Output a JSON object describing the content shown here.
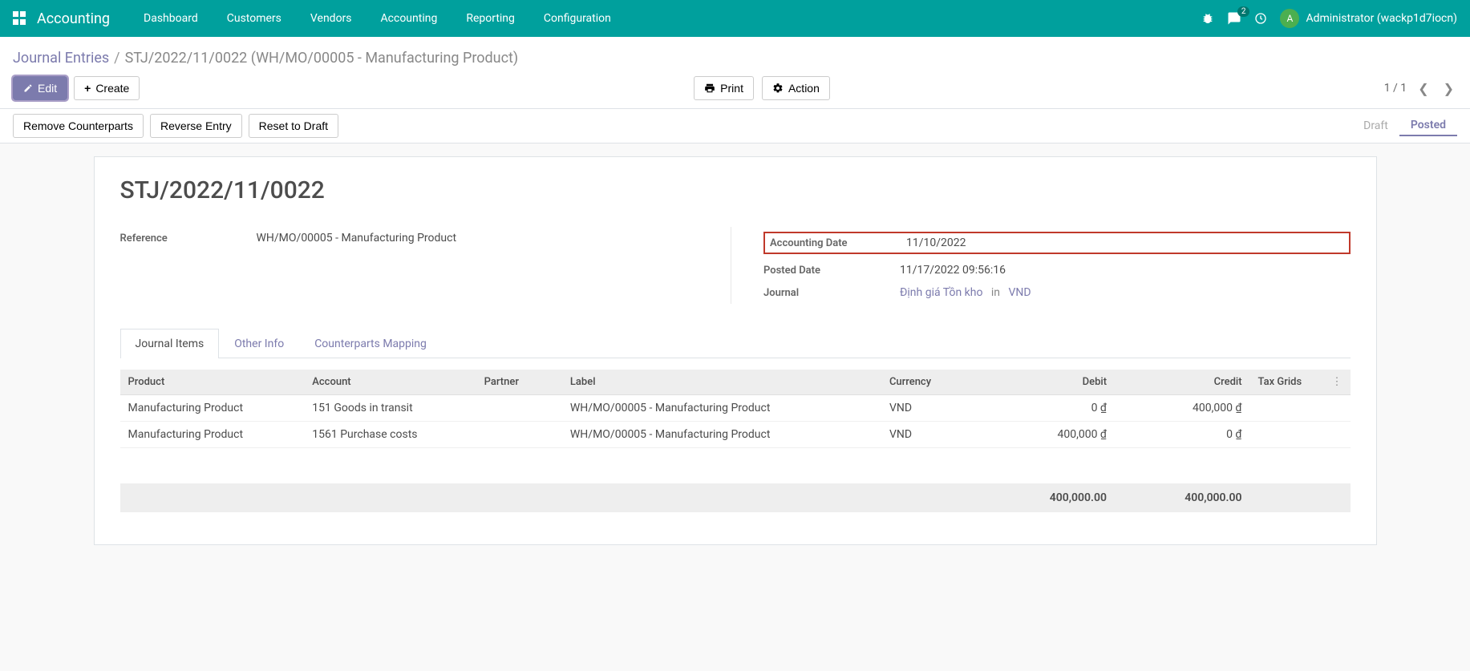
{
  "topbar": {
    "brand": "Accounting",
    "menu": [
      "Dashboard",
      "Customers",
      "Vendors",
      "Accounting",
      "Reporting",
      "Configuration"
    ],
    "messages_count": "2",
    "avatar_letter": "A",
    "user_name": "Administrator (wackp1d7iocn)"
  },
  "breadcrumb": {
    "root": "Journal Entries",
    "current": "STJ/2022/11/0022 (WH/MO/00005 - Manufacturing Product)"
  },
  "buttons": {
    "edit": "Edit",
    "create": "Create",
    "print": "Print",
    "action": "Action",
    "remove_counterparts": "Remove Counterparts",
    "reverse_entry": "Reverse Entry",
    "reset_draft": "Reset to Draft"
  },
  "pager": {
    "value": "1 / 1"
  },
  "status": {
    "draft": "Draft",
    "posted": "Posted"
  },
  "record": {
    "name": "STJ/2022/11/0022",
    "reference_label": "Reference",
    "reference": "WH/MO/00005 - Manufacturing Product",
    "accounting_date_label": "Accounting Date",
    "accounting_date": "11/10/2022",
    "posted_date_label": "Posted Date",
    "posted_date": "11/17/2022 09:56:16",
    "journal_label": "Journal",
    "journal_name": "Định giá Tồn kho",
    "journal_in": "in",
    "journal_currency": "VND"
  },
  "tabs": {
    "items": "Journal Items",
    "other": "Other Info",
    "counterparts": "Counterparts Mapping"
  },
  "table": {
    "headers": {
      "product": "Product",
      "account": "Account",
      "partner": "Partner",
      "label": "Label",
      "currency": "Currency",
      "debit": "Debit",
      "credit": "Credit",
      "tax_grids": "Tax Grids"
    },
    "rows": [
      {
        "product": "Manufacturing Product",
        "account": "151 Goods in transit",
        "partner": "",
        "label": "WH/MO/00005 - Manufacturing Product",
        "currency": "VND",
        "debit": "0 ₫",
        "credit": "400,000 ₫",
        "tax_grids": ""
      },
      {
        "product": "Manufacturing Product",
        "account": "1561 Purchase costs",
        "partner": "",
        "label": "WH/MO/00005 - Manufacturing Product",
        "currency": "VND",
        "debit": "400,000 ₫",
        "credit": "0 ₫",
        "tax_grids": ""
      }
    ],
    "totals": {
      "debit": "400,000.00",
      "credit": "400,000.00"
    }
  }
}
